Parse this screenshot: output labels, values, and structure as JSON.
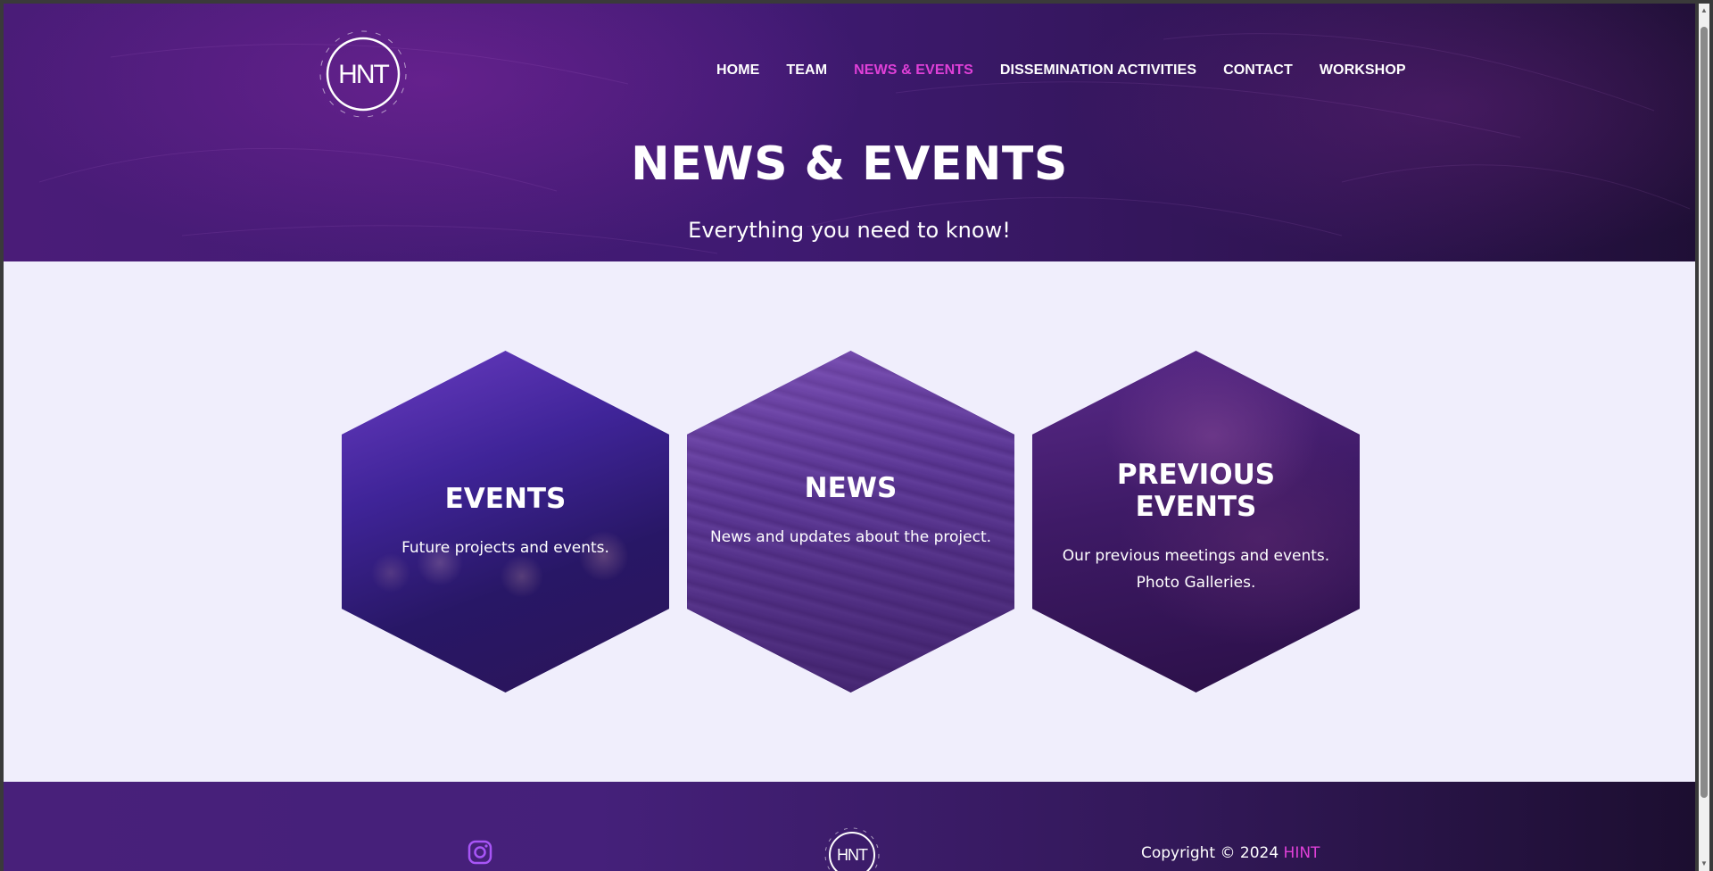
{
  "header": {
    "logo_text": "HNT",
    "nav": [
      {
        "label": "HOME",
        "active": false
      },
      {
        "label": "TEAM",
        "active": false
      },
      {
        "label": "NEWS & EVENTS",
        "active": true
      },
      {
        "label": "DISSEMINATION ACTIVITIES",
        "active": false
      },
      {
        "label": "CONTACT",
        "active": false
      },
      {
        "label": "WORKSHOP",
        "active": false
      }
    ],
    "title": "NEWS & EVENTS",
    "subtitle": "Everything you need to know!"
  },
  "cards": [
    {
      "title": "EVENTS",
      "description": "Future projects and events."
    },
    {
      "title": "NEWS",
      "description": "News and updates about the project."
    },
    {
      "title": "PREVIOUS EVENTS",
      "description": "Our previous meetings and events. Photo Galleries."
    }
  ],
  "footer": {
    "social_icon": "instagram-icon",
    "logo_text": "HNT",
    "copyright_prefix": "Copyright © 2024 ",
    "brand": "HINT"
  },
  "colors": {
    "accent": "#e040d8",
    "hero_bg": "#3f1a72",
    "page_bg": "#f0eefc",
    "instagram": "#a855f7"
  }
}
